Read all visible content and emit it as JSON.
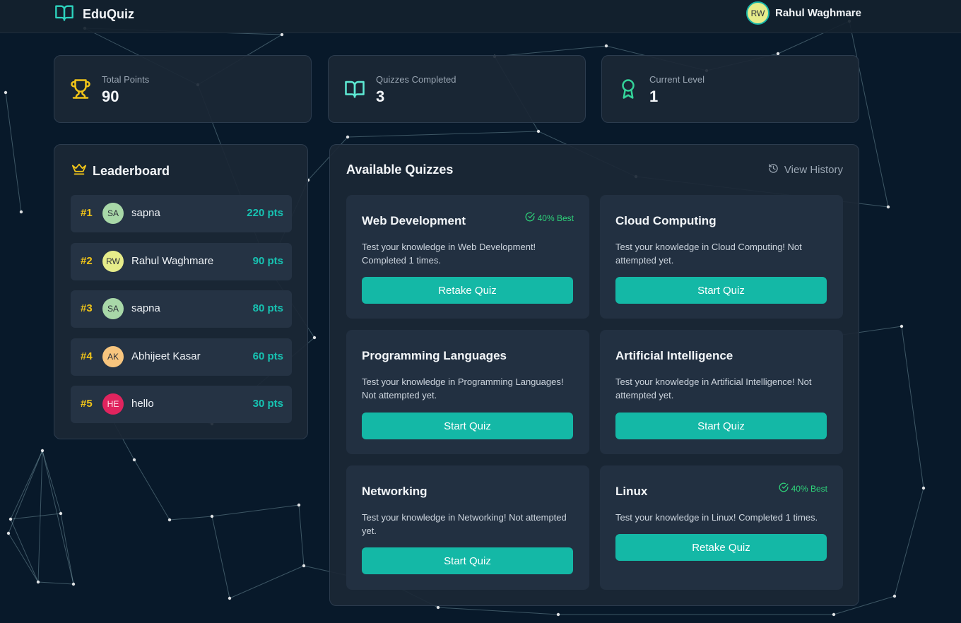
{
  "app": {
    "name": "EduQuiz"
  },
  "user": {
    "name": "Rahul Waghmare",
    "initials": "RW"
  },
  "stats": [
    {
      "label": "Total Points",
      "value": "90",
      "icon": "trophy-icon"
    },
    {
      "label": "Quizzes Completed",
      "value": "3",
      "icon": "book-icon"
    },
    {
      "label": "Current Level",
      "value": "1",
      "icon": "award-icon"
    }
  ],
  "leaderboard": {
    "title": "Leaderboard",
    "entries": [
      {
        "rank": "#1",
        "initials": "SA",
        "name": "sapna",
        "points": "220 pts",
        "avatar_color": "#a8d8a8"
      },
      {
        "rank": "#2",
        "initials": "RW",
        "name": "Rahul Waghmare",
        "points": "90 pts",
        "avatar_color": "#e6ec8a"
      },
      {
        "rank": "#3",
        "initials": "SA",
        "name": "sapna",
        "points": "80 pts",
        "avatar_color": "#a8d8a8"
      },
      {
        "rank": "#4",
        "initials": "AK",
        "name": "Abhijeet Kasar",
        "points": "60 pts",
        "avatar_color": "#f7c57e"
      },
      {
        "rank": "#5",
        "initials": "HE",
        "name": "hello",
        "points": "30 pts",
        "avatar_color": "#e0245e"
      }
    ]
  },
  "quizzes": {
    "title": "Available Quizzes",
    "history_label": "View History",
    "items": [
      {
        "name": "Web Development",
        "best": "40% Best",
        "description": "Test your knowledge in Web Development! Completed 1 times.",
        "button": "Retake Quiz"
      },
      {
        "name": "Cloud Computing",
        "best": "",
        "description": "Test your knowledge in Cloud Computing! Not attempted yet.",
        "button": "Start Quiz"
      },
      {
        "name": "Programming Languages",
        "best": "",
        "description": "Test your knowledge in Programming Languages! Not attempted yet.",
        "button": "Start Quiz"
      },
      {
        "name": "Artificial Intelligence",
        "best": "",
        "description": "Test your knowledge in Artificial Intelligence! Not attempted yet.",
        "button": "Start Quiz"
      },
      {
        "name": "Networking",
        "best": "",
        "description": "Test your knowledge in Networking! Not attempted yet.",
        "button": "Start Quiz"
      },
      {
        "name": "Linux",
        "best": "40% Best",
        "description": "Test your knowledge in Linux! Completed 1 times.",
        "button": "Retake Quiz"
      }
    ]
  },
  "colors": {
    "accent": "#14b8a6",
    "rank": "#f0c419",
    "points": "#17c3b2",
    "best": "#2ed47a",
    "background": "#08192a"
  }
}
